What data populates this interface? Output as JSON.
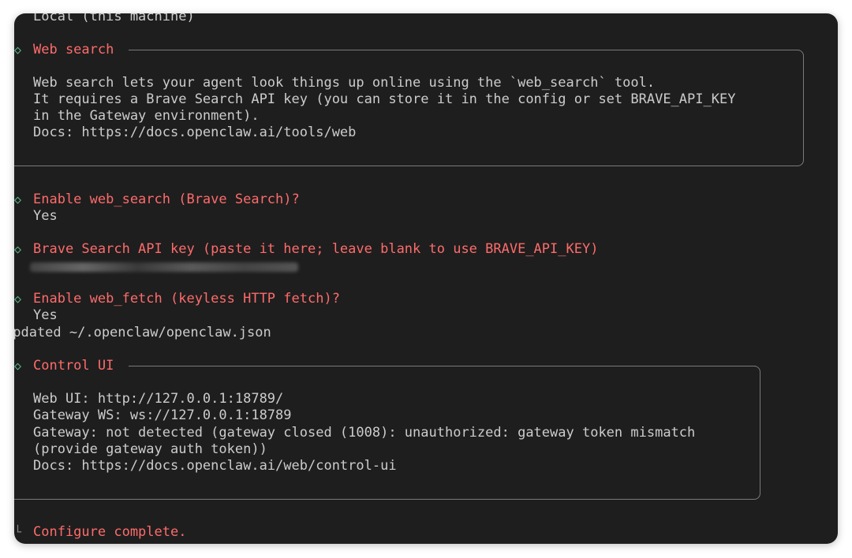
{
  "terminal": {
    "top_cut_line": "Local (this machine)",
    "web_search": {
      "title": "Web search",
      "lines": [
        "Web search lets your agent look things up online using the `web_search` tool.",
        "It requires a Brave Search API key (you can store it in the config or set BRAVE_API_KEY",
        "in the Gateway environment).",
        "Docs: https://docs.openclaw.ai/tools/web"
      ]
    },
    "prompt_enable_search": "Enable web_search (Brave Search)?",
    "answer_enable_search": "Yes",
    "prompt_api_key": "Brave Search API key (paste it here; leave blank to use BRAVE_API_KEY)",
    "prompt_enable_fetch": "Enable web_fetch (keyless HTTP fetch)?",
    "answer_enable_fetch": "Yes",
    "updated_line": "Updated ~/.openclaw/openclaw.json",
    "control_ui": {
      "title": "Control UI",
      "lines": [
        "Web UI: http://127.0.0.1:18789/",
        "Gateway WS: ws://127.0.0.1:18789",
        "Gateway: not detected (gateway closed (1008): unauthorized: gateway token mismatch",
        "(provide gateway auth token))",
        "Docs: https://docs.openclaw.ai/web/control-ui"
      ]
    },
    "complete_line": "Configure complete."
  },
  "colors": {
    "background": "#1e1e1e",
    "heading": "#ff6b6b",
    "text": "#cccccc",
    "border": "#7a7a7a",
    "marker": "#5dbb8a"
  }
}
